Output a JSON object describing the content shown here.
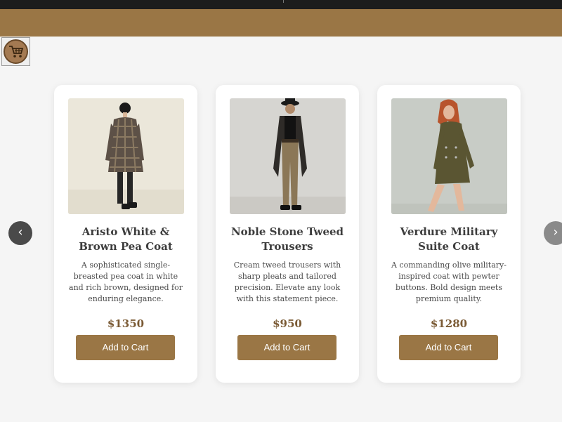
{
  "colors": {
    "brand": "#9a7645",
    "topbar": "#1c1c1c",
    "price": "#7a5a34"
  },
  "cart": {
    "icon": "shopping-cart-icon"
  },
  "carousel": {
    "prev_label": "‹",
    "next_label": "›"
  },
  "products": [
    {
      "title": "Aristo White & Brown Pea Coat",
      "description": "A sophisticated single-breasted pea coat in white and rich brown, designed for enduring elegance.",
      "price": "$1350",
      "button": "Add to Cart"
    },
    {
      "title": "Noble Stone Tweed Trousers",
      "description": "Cream tweed trousers with sharp pleats and tailored precision. Elevate any look with this statement piece.",
      "price": "$950",
      "button": "Add to Cart"
    },
    {
      "title": "Verdure Military Suite Coat",
      "description": "A commanding olive military-inspired coat with pewter buttons. Bold design meets premium quality.",
      "price": "$1280",
      "button": "Add to Cart"
    }
  ]
}
